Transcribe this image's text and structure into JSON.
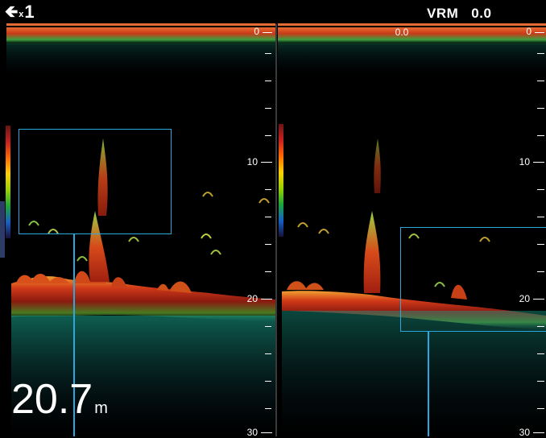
{
  "toolbar": {
    "back_icon": "left-arrow-icon",
    "multiplier_prefix": "x",
    "multiplier_value": "1",
    "vrm_label": "VRM",
    "vrm_value": "0.0"
  },
  "left_panel": {
    "scale_labels": [
      "0",
      "10",
      "20",
      "30"
    ],
    "depth_value": "20.7",
    "depth_unit": "m"
  },
  "right_panel": {
    "vrm_marker": "0.0",
    "scale_labels": [
      "0",
      "10",
      "20",
      "30"
    ]
  },
  "colors": {
    "zoom_box": "#29a9e0",
    "surface_line": "#e46d35",
    "background": "#000000"
  }
}
